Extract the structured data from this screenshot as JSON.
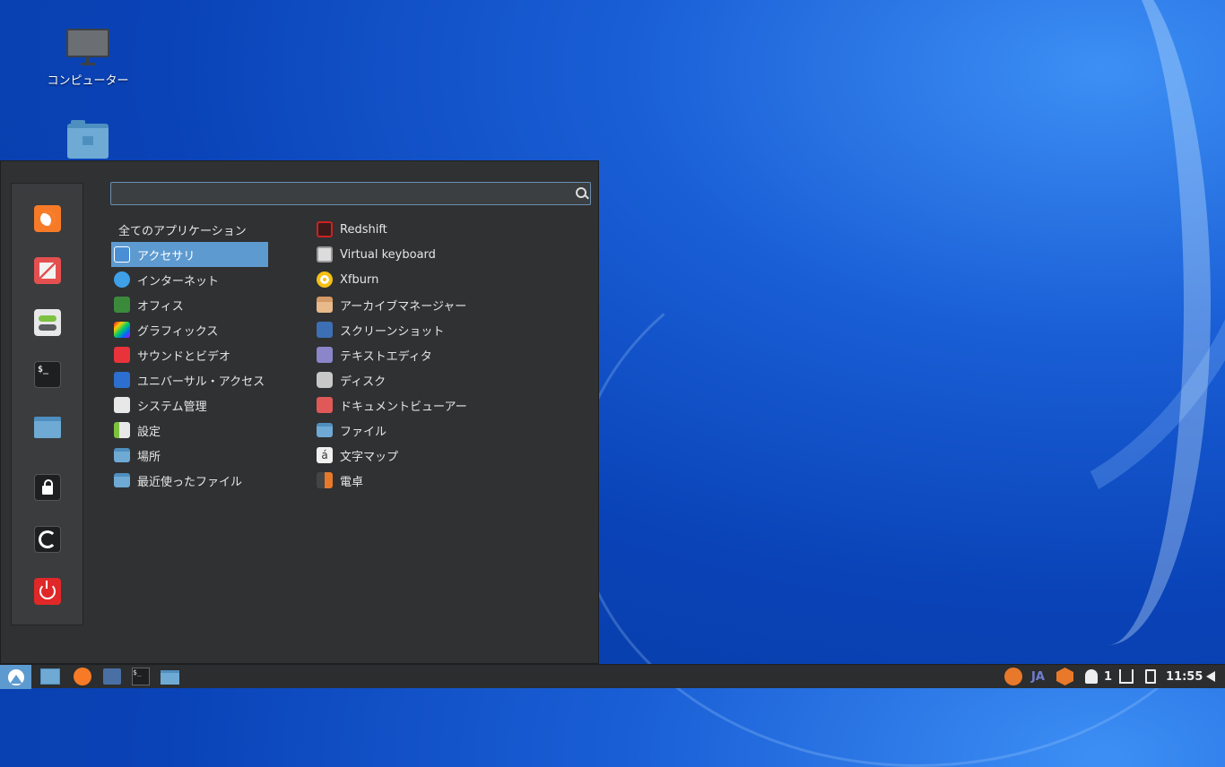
{
  "desktop": {
    "icons": [
      {
        "label": "コンピューター"
      },
      {
        "label": ""
      }
    ]
  },
  "menu": {
    "search": {
      "placeholder": "",
      "value": ""
    },
    "favorites": [
      "firefox-icon",
      "update-manager-icon",
      "settings-icon",
      "terminal-icon",
      "files-icon",
      "lock-icon",
      "logout-icon",
      "power-icon"
    ],
    "categories": [
      {
        "label": "全てのアプリケーション"
      },
      {
        "label": "アクセサリ"
      },
      {
        "label": "インターネット"
      },
      {
        "label": "オフィス"
      },
      {
        "label": "グラフィックス"
      },
      {
        "label": "サウンドとビデオ"
      },
      {
        "label": "ユニバーサル・アクセス"
      },
      {
        "label": "システム管理"
      },
      {
        "label": "設定"
      },
      {
        "label": "場所"
      },
      {
        "label": "最近使ったファイル"
      }
    ],
    "selected_category": "アクセサリ",
    "apps": [
      {
        "label": "Redshift"
      },
      {
        "label": "Virtual keyboard"
      },
      {
        "label": "Xfburn"
      },
      {
        "label": "アーカイブマネージャー"
      },
      {
        "label": "スクリーンショット"
      },
      {
        "label": "テキストエディタ"
      },
      {
        "label": "ディスク"
      },
      {
        "label": "ドキュメントビューアー"
      },
      {
        "label": "ファイル"
      },
      {
        "label": "文字マップ"
      },
      {
        "label": "電卓"
      }
    ]
  },
  "taskbar": {
    "tray": {
      "keyboard_layout": "JA",
      "notifications_count": "1",
      "clock": "11:55"
    }
  },
  "colors": {
    "accent": "#5d9ad0",
    "menu_bg": "#2f3133",
    "taskbar_bg": "#2b2d2f"
  }
}
